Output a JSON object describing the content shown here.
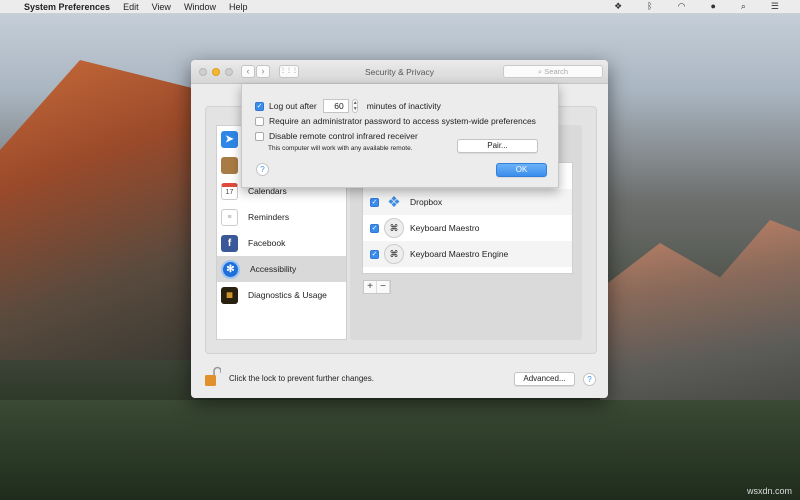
{
  "menubar": {
    "apple": "",
    "app": "System Preferences",
    "items": [
      "Edit",
      "View",
      "Window",
      "Help"
    ],
    "tray": [
      "dropbox-icon",
      "bluetooth-icon",
      "wifi-icon",
      "user-icon",
      "spotlight-icon",
      "notification-icon"
    ]
  },
  "window": {
    "title": "Security & Privacy",
    "search_placeholder": "Search",
    "nav_back": "‹",
    "nav_forward": "›",
    "grid": "⋮⋮⋮"
  },
  "sheet": {
    "logout_checked": true,
    "logout_label": "Log out after",
    "logout_minutes": "60",
    "logout_suffix": "minutes of inactivity",
    "admin_checked": false,
    "admin_label": "Require an administrator password to access system-wide preferences",
    "ir_checked": false,
    "ir_label": "Disable remote control infrared receiver",
    "ir_note": "This computer will work with any available remote.",
    "pair_button": "Pair...",
    "ok_button": "OK",
    "help": "?"
  },
  "sidebar": {
    "items": [
      {
        "label": "",
        "icon": "location-icon"
      },
      {
        "label": "",
        "icon": "contacts-icon"
      },
      {
        "label": "Calendars",
        "icon": "calendar-icon",
        "icon_text": "17"
      },
      {
        "label": "Reminders",
        "icon": "reminders-icon"
      },
      {
        "label": "Facebook",
        "icon": "facebook-icon",
        "icon_text": "f"
      },
      {
        "label": "Accessibility",
        "icon": "accessibility-icon",
        "selected": true
      },
      {
        "label": "Diagnostics & Usage",
        "icon": "diagnostics-icon"
      }
    ]
  },
  "apps": [
    {
      "name": "Dropbox",
      "checked": true
    },
    {
      "name": "Keyboard Maestro",
      "checked": true
    },
    {
      "name": "Keyboard Maestro Engine",
      "checked": true
    }
  ],
  "list_controls": {
    "add": "+",
    "remove": "−"
  },
  "footer": {
    "lock_text": "Click the lock to prevent further changes.",
    "advanced_button": "Advanced...",
    "help": "?"
  },
  "watermark": "wsxdn.com",
  "colors": {
    "accent": "#3b8ded"
  }
}
